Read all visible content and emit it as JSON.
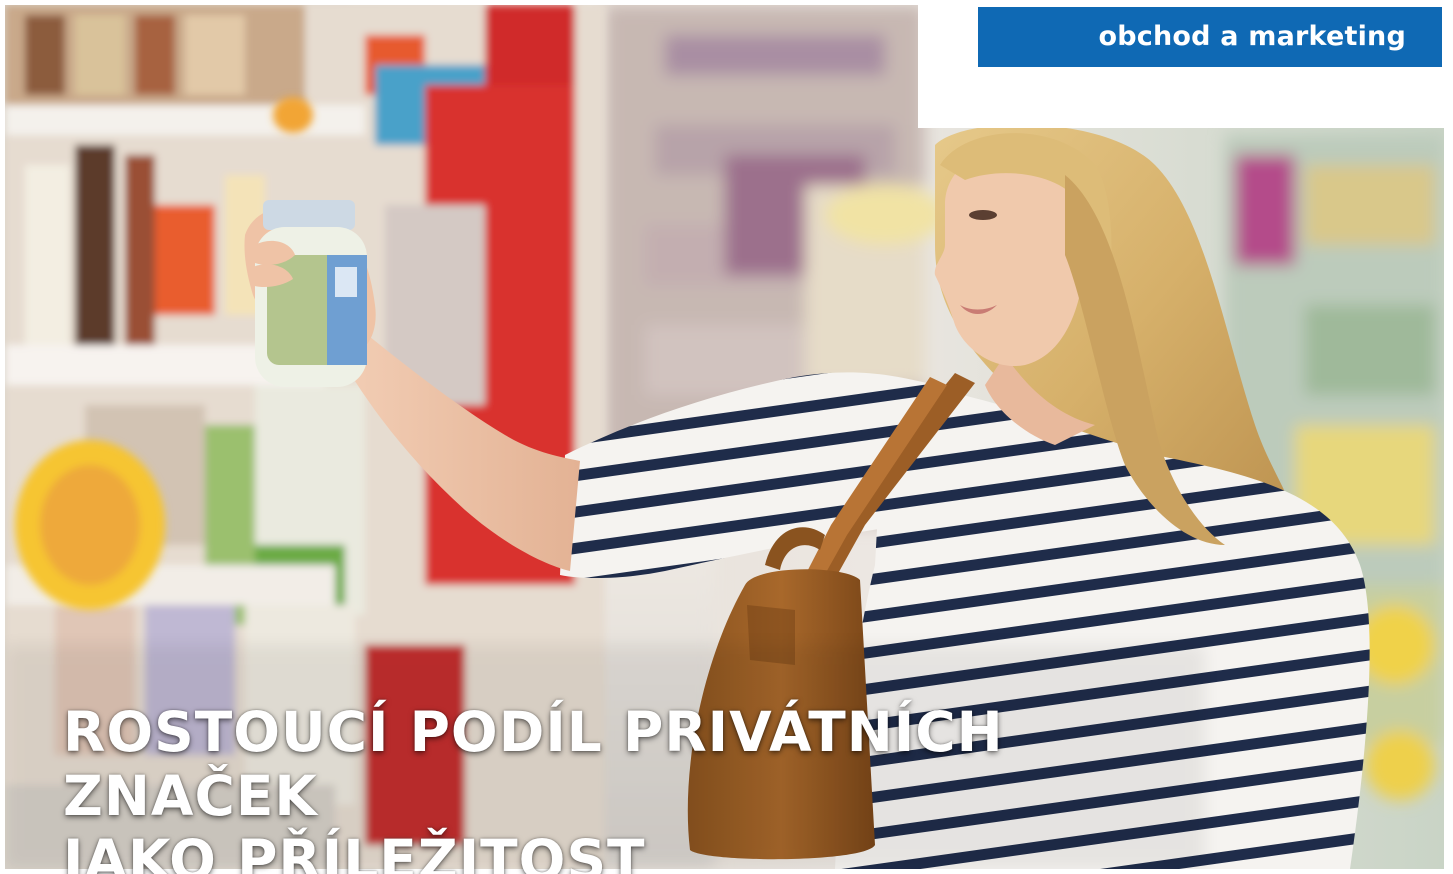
{
  "section": {
    "label": "obchod a marketing",
    "color": "#0f69b4"
  },
  "headline": {
    "line1": "ROSTOUCÍ PODÍL PRIVÁTNÍCH ZNAČEK",
    "line2": "JAKO PŘÍLEŽITOST"
  },
  "photo": {
    "subject": "woman-in-striped-shirt-holding-jar-in-supermarket-aisle-icon"
  }
}
